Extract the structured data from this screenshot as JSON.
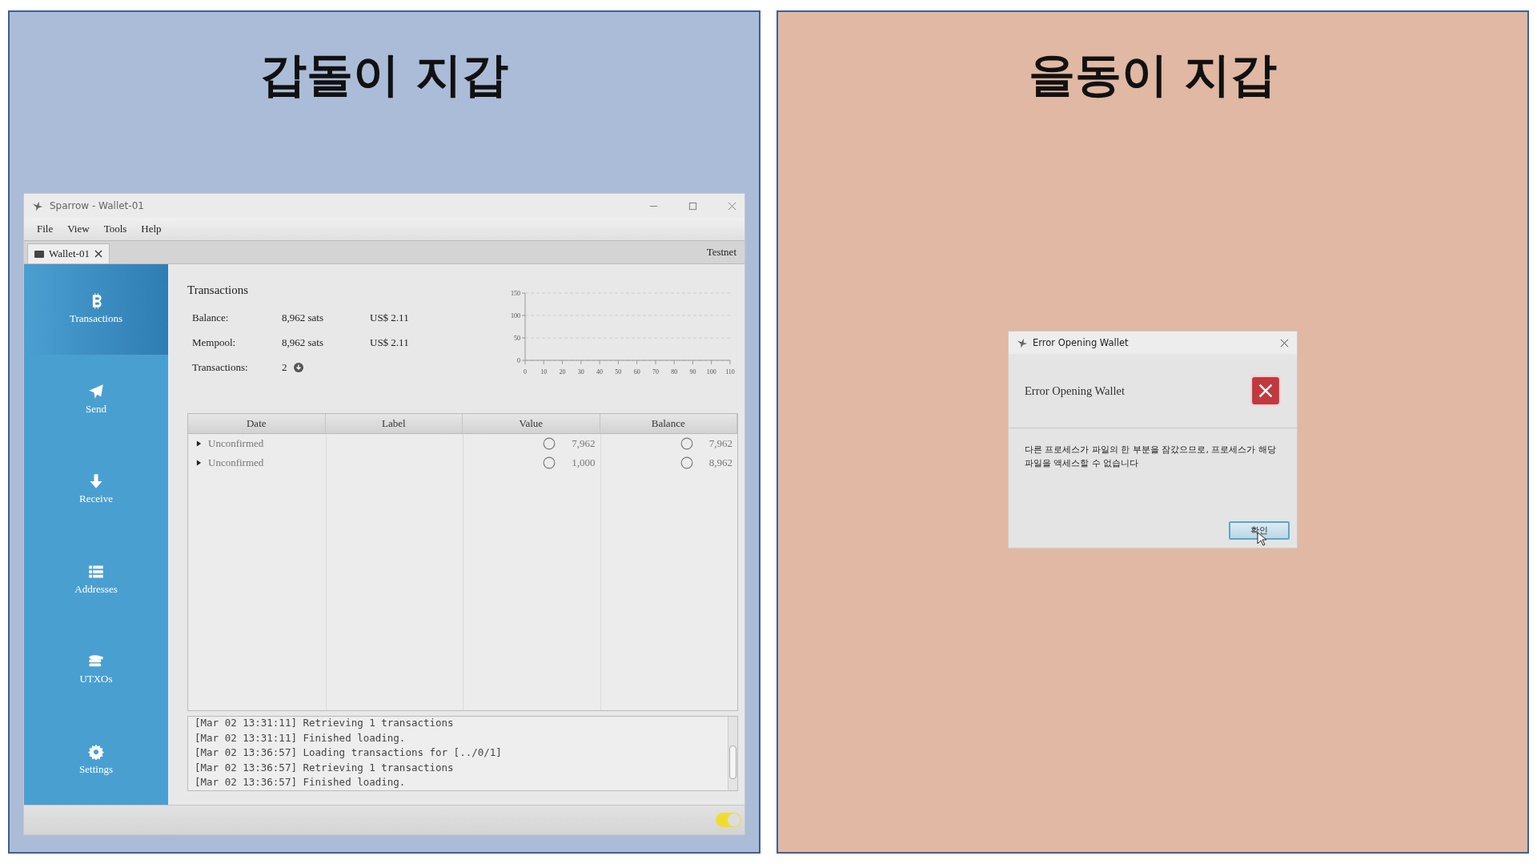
{
  "panels": [
    {
      "title": "갑돌이 지갑",
      "kind": "wallet"
    },
    {
      "title": "을동이 지갑",
      "kind": "dialog"
    }
  ],
  "window": {
    "title": "Sparrow - Wallet-01",
    "menu": [
      "File",
      "View",
      "Tools",
      "Help"
    ],
    "tab": "Wallet-01",
    "network": "Testnet"
  },
  "sidebar": {
    "items": [
      {
        "label": "Transactions",
        "kind": "bitcoin",
        "selected": true
      },
      {
        "label": "Send",
        "kind": "send",
        "selected": false
      },
      {
        "label": "Receive",
        "kind": "receive",
        "selected": false
      },
      {
        "label": "Addresses",
        "kind": "addresses",
        "selected": false
      },
      {
        "label": "UTXOs",
        "kind": "utxos",
        "selected": false
      },
      {
        "label": "Settings",
        "kind": "settings",
        "selected": false
      }
    ]
  },
  "summary": {
    "heading": "Transactions",
    "rows": [
      {
        "label": "Balance:",
        "value": "8,962 sats",
        "fiat": "US$ 2.11"
      },
      {
        "label": "Mempool:",
        "value": "8,962 sats",
        "fiat": "US$ 2.11"
      },
      {
        "label": "Transactions:",
        "value": "2"
      }
    ],
    "chart_data": {
      "type": "line",
      "xlim": [
        0,
        110
      ],
      "ylim": [
        0,
        150
      ],
      "xticks": [
        0,
        10,
        20,
        30,
        40,
        50,
        60,
        70,
        80,
        90,
        100,
        110
      ],
      "yticks": [
        0,
        50,
        100,
        150
      ]
    }
  },
  "table": {
    "columns": [
      "Date",
      "Label",
      "Value",
      "Balance"
    ],
    "rows": [
      {
        "date": "Unconfirmed",
        "expanded": false,
        "value": "7,962",
        "balance": "7,962"
      },
      {
        "date": "Unconfirmed",
        "expanded": false,
        "value": "1,000",
        "balance": "8,962"
      }
    ]
  },
  "log": [
    "[Mar 02 13:31:11] Retrieving 1 transactions",
    "[Mar 02 13:31:11] Finished loading.",
    "[Mar 02 13:36:57] Loading transactions for [../0/1]",
    "[Mar 02 13:36:57] Retrieving 1 transactions",
    "[Mar 02 13:36:57] Finished loading."
  ],
  "status_bar": {
    "toggle_on": true
  },
  "dialog": {
    "title": "Error Opening Wallet",
    "heading": "Error Opening Wallet",
    "message": "다른 프로세스가 파일의 한 부분을 잠갔으므로, 프로세스가 해당 파일을 액세스할 수 없습니다",
    "button": "확인"
  }
}
